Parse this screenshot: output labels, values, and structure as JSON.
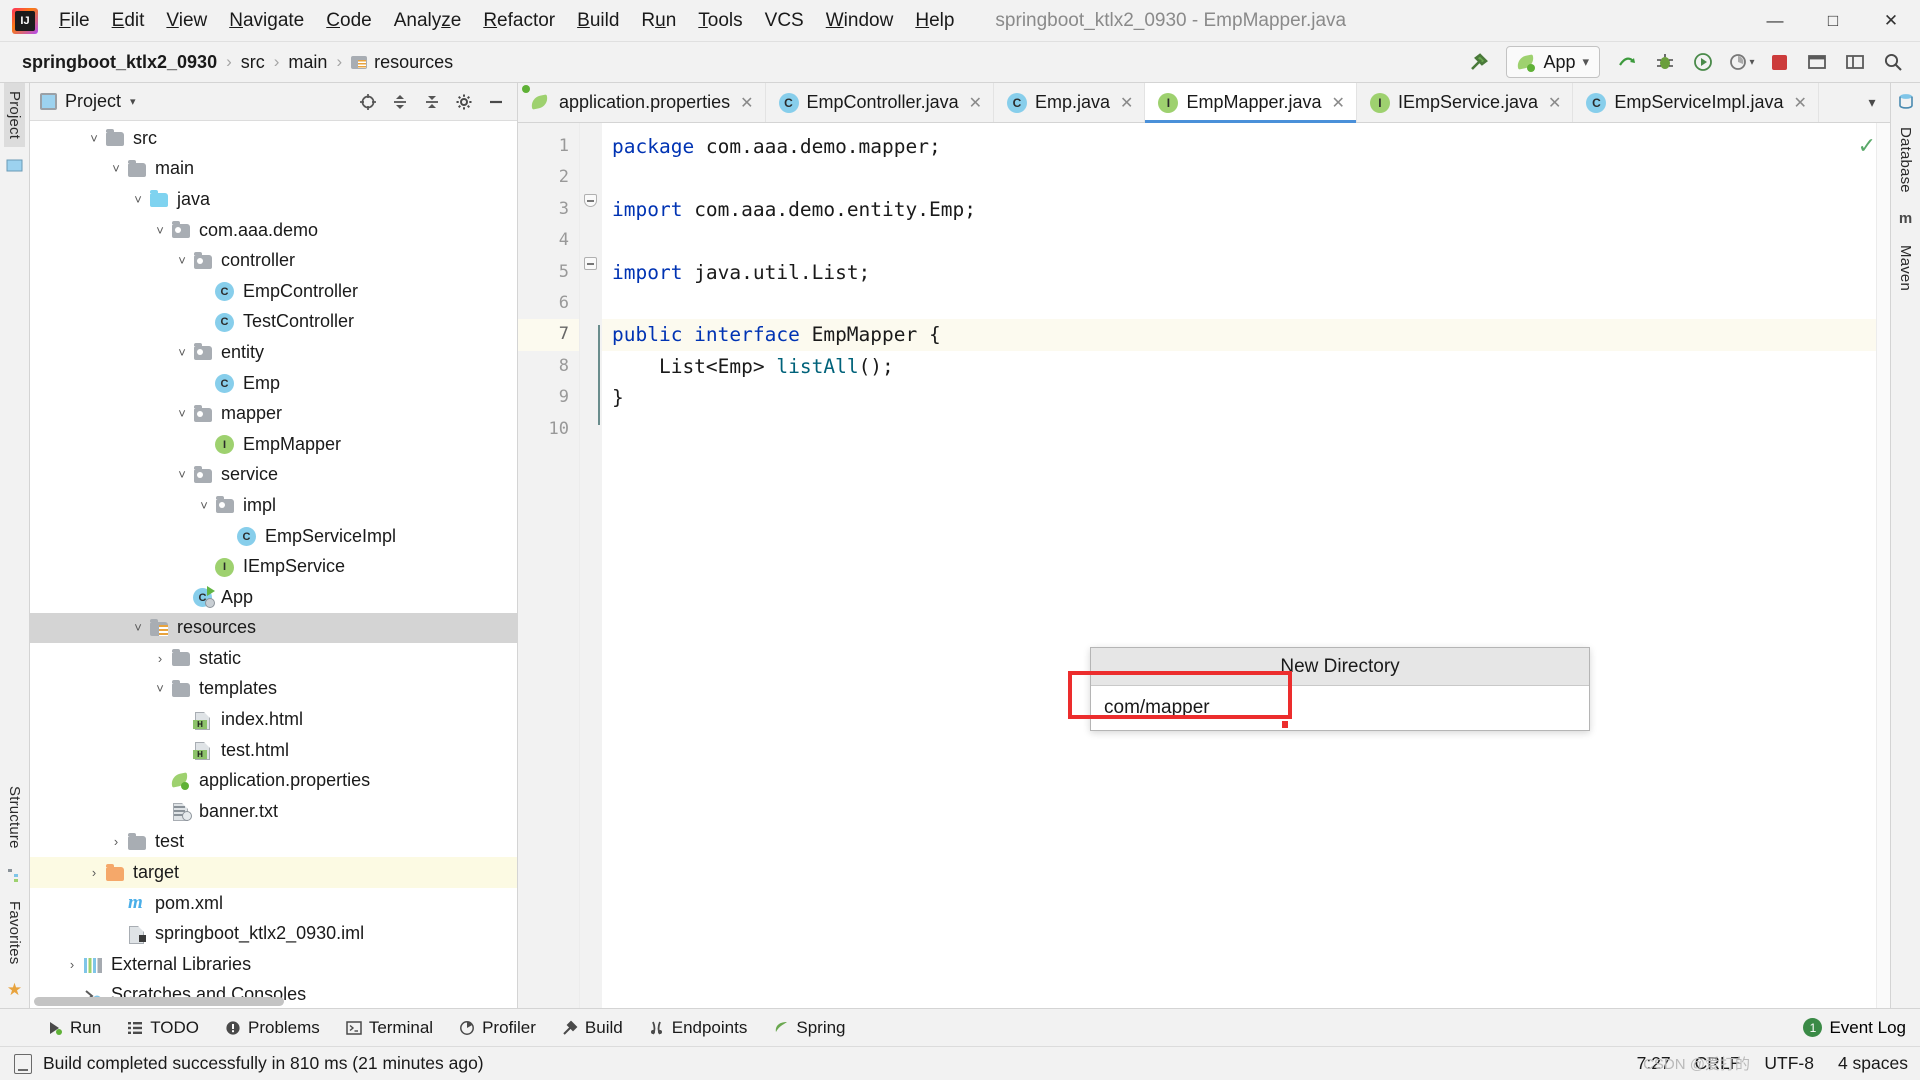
{
  "window": {
    "title": "springboot_ktlx2_0930 - EmpMapper.java",
    "logo_icon": "intellij-idea-logo",
    "controls": [
      {
        "name": "minimize",
        "glyph": "—"
      },
      {
        "name": "maximize",
        "glyph": "❐"
      },
      {
        "name": "close",
        "glyph": "✕"
      }
    ]
  },
  "menu": [
    {
      "label": "File",
      "mnemonic": "F"
    },
    {
      "label": "Edit",
      "mnemonic": "E"
    },
    {
      "label": "View",
      "mnemonic": "V"
    },
    {
      "label": "Navigate",
      "mnemonic": "N"
    },
    {
      "label": "Code",
      "mnemonic": "C"
    },
    {
      "label": "Analyze",
      "mnemonic": "z"
    },
    {
      "label": "Refactor",
      "mnemonic": "R"
    },
    {
      "label": "Build",
      "mnemonic": "B"
    },
    {
      "label": "Run",
      "mnemonic": "u"
    },
    {
      "label": "Tools",
      "mnemonic": "T"
    },
    {
      "label": "VCS",
      "mnemonic": ""
    },
    {
      "label": "Window",
      "mnemonic": "W"
    },
    {
      "label": "Help",
      "mnemonic": "H"
    }
  ],
  "breadcrumb": {
    "items": [
      {
        "label": "springboot_ktlx2_0930",
        "bold": true,
        "icon": ""
      },
      {
        "label": "src",
        "bold": false,
        "icon": ""
      },
      {
        "label": "main",
        "bold": false,
        "icon": ""
      },
      {
        "label": "resources",
        "bold": false,
        "icon": "resources-folder-icon"
      }
    ],
    "separator": "›"
  },
  "toolbar": {
    "build_label": "build-hammer-icon",
    "run_config": {
      "label": "App",
      "icon": "spring-leaf-icon",
      "dropdown": "▾"
    },
    "icons": [
      {
        "name": "run-with-coverage-icon",
        "glyph": "⮕"
      },
      {
        "name": "debug-icon",
        "glyph": "🐞"
      },
      {
        "name": "run-icon",
        "glyph": "➳"
      },
      {
        "name": "profile-icon",
        "glyph": "◔"
      },
      {
        "name": "stop-icon",
        "glyph": "■"
      },
      {
        "name": "updates-icon",
        "glyph": "⬚"
      },
      {
        "name": "layout-icon",
        "glyph": "▭"
      },
      {
        "name": "search-everywhere-icon",
        "glyph": "🔍"
      }
    ]
  },
  "left_rail": {
    "tabs": [
      {
        "label": "Project",
        "selected": true
      }
    ],
    "bottom_tabs": [
      {
        "label": "Structure"
      },
      {
        "label": "Favorites"
      }
    ],
    "bottom_icons": [
      "structure-icon",
      "star-icon"
    ]
  },
  "right_rail": {
    "tabs": [
      {
        "label": "Database"
      },
      {
        "label": "Maven"
      }
    ],
    "icons": [
      "database-icon",
      "maven-m-icon"
    ]
  },
  "project_panel": {
    "title": "Project",
    "dropdown": "▾",
    "header_icons": [
      {
        "name": "select-opened-file-icon",
        "glyph": "⊕"
      },
      {
        "name": "expand-all-icon",
        "glyph": "⬍"
      },
      {
        "name": "collapse-all-icon",
        "glyph": "⬏"
      },
      {
        "name": "settings-gear-icon",
        "glyph": "⚙"
      },
      {
        "name": "hide-panel-icon",
        "glyph": "—"
      }
    ],
    "tree": [
      {
        "label": "src",
        "indent": 2,
        "arrow": "˅",
        "icon": "folder",
        "mod": ""
      },
      {
        "label": "main",
        "indent": 3,
        "arrow": "˅",
        "icon": "folder",
        "mod": ""
      },
      {
        "label": "java",
        "indent": 4,
        "arrow": "˅",
        "icon": "folder",
        "mod": "blue"
      },
      {
        "label": "com.aaa.demo",
        "indent": 5,
        "arrow": "˅",
        "icon": "folder",
        "mod": "pkg"
      },
      {
        "label": "controller",
        "indent": 6,
        "arrow": "˅",
        "icon": "folder",
        "mod": "pkg"
      },
      {
        "label": "EmpController",
        "indent": 7,
        "arrow": "",
        "icon": "class",
        "mod": ""
      },
      {
        "label": "TestController",
        "indent": 7,
        "arrow": "",
        "icon": "class",
        "mod": ""
      },
      {
        "label": "entity",
        "indent": 6,
        "arrow": "˅",
        "icon": "folder",
        "mod": "pkg"
      },
      {
        "label": "Emp",
        "indent": 7,
        "arrow": "",
        "icon": "class",
        "mod": ""
      },
      {
        "label": "mapper",
        "indent": 6,
        "arrow": "˅",
        "icon": "folder",
        "mod": "pkg"
      },
      {
        "label": "EmpMapper",
        "indent": 7,
        "arrow": "",
        "icon": "interface",
        "mod": ""
      },
      {
        "label": "service",
        "indent": 6,
        "arrow": "˅",
        "icon": "folder",
        "mod": "pkg"
      },
      {
        "label": "impl",
        "indent": 7,
        "arrow": "˅",
        "icon": "folder",
        "mod": "pkg"
      },
      {
        "label": "EmpServiceImpl",
        "indent": 8,
        "arrow": "",
        "icon": "class",
        "mod": ""
      },
      {
        "label": "IEmpService",
        "indent": 7,
        "arrow": "",
        "icon": "interface",
        "mod": ""
      },
      {
        "label": "App",
        "indent": 6,
        "arrow": "",
        "icon": "app-class",
        "mod": ""
      },
      {
        "label": "resources",
        "indent": 4,
        "arrow": "˅",
        "icon": "folder",
        "mod": "res",
        "selected": true
      },
      {
        "label": "static",
        "indent": 5,
        "arrow": "›",
        "icon": "folder",
        "mod": ""
      },
      {
        "label": "templates",
        "indent": 5,
        "arrow": "˅",
        "icon": "folder",
        "mod": ""
      },
      {
        "label": "index.html",
        "indent": 6,
        "arrow": "",
        "icon": "html-file",
        "mod": ""
      },
      {
        "label": "test.html",
        "indent": 6,
        "arrow": "",
        "icon": "html-file",
        "mod": ""
      },
      {
        "label": "application.properties",
        "indent": 5,
        "arrow": "",
        "icon": "spring-properties",
        "mod": ""
      },
      {
        "label": "banner.txt",
        "indent": 5,
        "arrow": "",
        "icon": "text-file",
        "mod": ""
      },
      {
        "label": "test",
        "indent": 3,
        "arrow": "›",
        "icon": "folder",
        "mod": ""
      },
      {
        "label": "target",
        "indent": 2,
        "arrow": "›",
        "icon": "folder",
        "mod": "orange",
        "excluded": true
      },
      {
        "label": "pom.xml",
        "indent": 3,
        "arrow": "",
        "icon": "maven-file",
        "mod": ""
      },
      {
        "label": "springboot_ktlx2_0930.iml",
        "indent": 3,
        "arrow": "",
        "icon": "iml-file",
        "mod": ""
      },
      {
        "label": "External Libraries",
        "indent": 1,
        "arrow": "›",
        "icon": "libraries",
        "mod": ""
      },
      {
        "label": "Scratches and Consoles",
        "indent": 1,
        "arrow": "",
        "icon": "scratches",
        "mod": ""
      }
    ]
  },
  "editor": {
    "tabs": [
      {
        "label": "application.properties",
        "icon": "spring-properties",
        "active": false
      },
      {
        "label": "EmpController.java",
        "icon": "class",
        "active": false
      },
      {
        "label": "Emp.java",
        "icon": "class",
        "active": false
      },
      {
        "label": "EmpMapper.java",
        "icon": "interface",
        "active": true
      },
      {
        "label": "IEmpService.java",
        "icon": "interface",
        "active": false
      },
      {
        "label": "EmpServiceImpl.java",
        "icon": "class",
        "active": false
      }
    ],
    "tabs_overflow": "˅",
    "close_glyph": "✕",
    "inspection_status": "✓",
    "line_numbers": [
      "1",
      "2",
      "3",
      "4",
      "5",
      "6",
      "7",
      "8",
      "9",
      "10"
    ],
    "highlight_line": 7,
    "code_lines": [
      {
        "n": 1,
        "tokens": [
          {
            "t": "package",
            "c": "kw"
          },
          {
            "t": " com.aaa.demo.mapper;",
            "c": "pl"
          }
        ]
      },
      {
        "n": 2,
        "tokens": []
      },
      {
        "n": 3,
        "tokens": [
          {
            "t": "import",
            "c": "kw"
          },
          {
            "t": " com.aaa.demo.entity.Emp;",
            "c": "pl"
          }
        ]
      },
      {
        "n": 4,
        "tokens": []
      },
      {
        "n": 5,
        "tokens": [
          {
            "t": "import",
            "c": "kw"
          },
          {
            "t": " java.util.List;",
            "c": "pl"
          }
        ]
      },
      {
        "n": 6,
        "tokens": []
      },
      {
        "n": 7,
        "tokens": [
          {
            "t": "public interface",
            "c": "kw"
          },
          {
            "t": " EmpMapper {",
            "c": "pl"
          }
        ]
      },
      {
        "n": 8,
        "tokens": [
          {
            "t": "    List<Emp> ",
            "c": "pl"
          },
          {
            "t": "listAll",
            "c": "mth"
          },
          {
            "t": "();",
            "c": "pl"
          }
        ]
      },
      {
        "n": 9,
        "tokens": [
          {
            "t": "}",
            "c": "pl"
          }
        ]
      },
      {
        "n": 10,
        "tokens": []
      }
    ]
  },
  "new_directory_dialog": {
    "title": "New Directory",
    "input_value": "com/mapper",
    "highlight_color": "#ec2d2d"
  },
  "tool_windows": [
    {
      "label": "Run",
      "icon": "run-triangle-icon"
    },
    {
      "label": "TODO",
      "icon": "todo-list-icon"
    },
    {
      "label": "Problems",
      "icon": "problems-icon"
    },
    {
      "label": "Terminal",
      "icon": "terminal-icon"
    },
    {
      "label": "Profiler",
      "icon": "profiler-icon"
    },
    {
      "label": "Build",
      "icon": "build-hammer-icon"
    },
    {
      "label": "Endpoints",
      "icon": "endpoints-icon"
    },
    {
      "label": "Spring",
      "icon": "spring-leaf-icon"
    }
  ],
  "event_log": {
    "label": "Event Log",
    "badge": "1"
  },
  "status_bar": {
    "message": "Build completed successfully in 810 ms (21 minutes ago)",
    "icon": "status-message-icon",
    "caret_position": "7:27",
    "line_separator": "CRLF",
    "encoding": "UTF-8",
    "indent": "4 spaces",
    "watermark": "CSDN @爱打的"
  }
}
